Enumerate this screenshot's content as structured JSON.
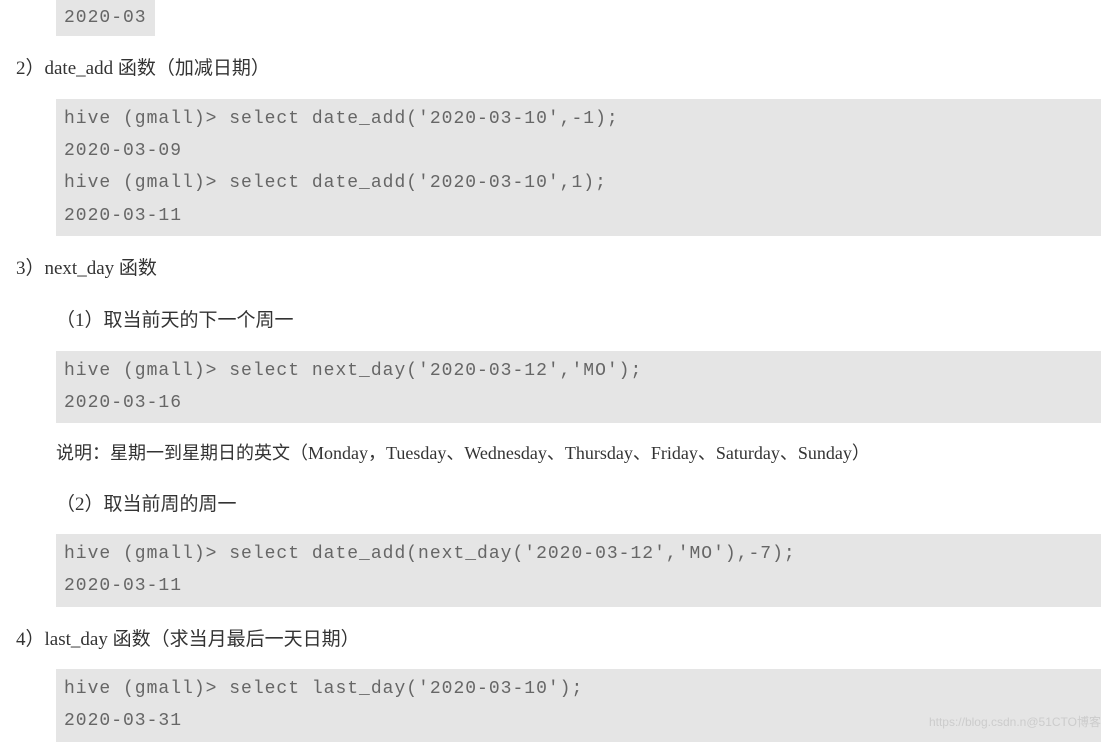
{
  "block0": "2020-03",
  "section2": {
    "title": "2）date_add 函数（加减日期）",
    "code": "hive (gmall)> select date_add('2020-03-10',-1);\n2020-03-09\nhive (gmall)> select date_add('2020-03-10',1);\n2020-03-11"
  },
  "section3": {
    "title": "3）next_day 函数",
    "sub1": {
      "title": "（1）取当前天的下一个周一",
      "code": "hive (gmall)> select next_day('2020-03-12','MO');\n2020-03-16",
      "description": "说明：星期一到星期日的英文（Monday，Tuesday、Wednesday、Thursday、Friday、Saturday、Sunday）"
    },
    "sub2": {
      "title": "（2）取当前周的周一",
      "code": "hive (gmall)> select date_add(next_day('2020-03-12','MO'),-7);\n2020-03-11"
    }
  },
  "section4": {
    "title": "4）last_day 函数（求当月最后一天日期）",
    "code": "hive (gmall)> select last_day('2020-03-10');\n2020-03-31"
  },
  "watermark": "https://blog.csdn.n@51CTO博客"
}
